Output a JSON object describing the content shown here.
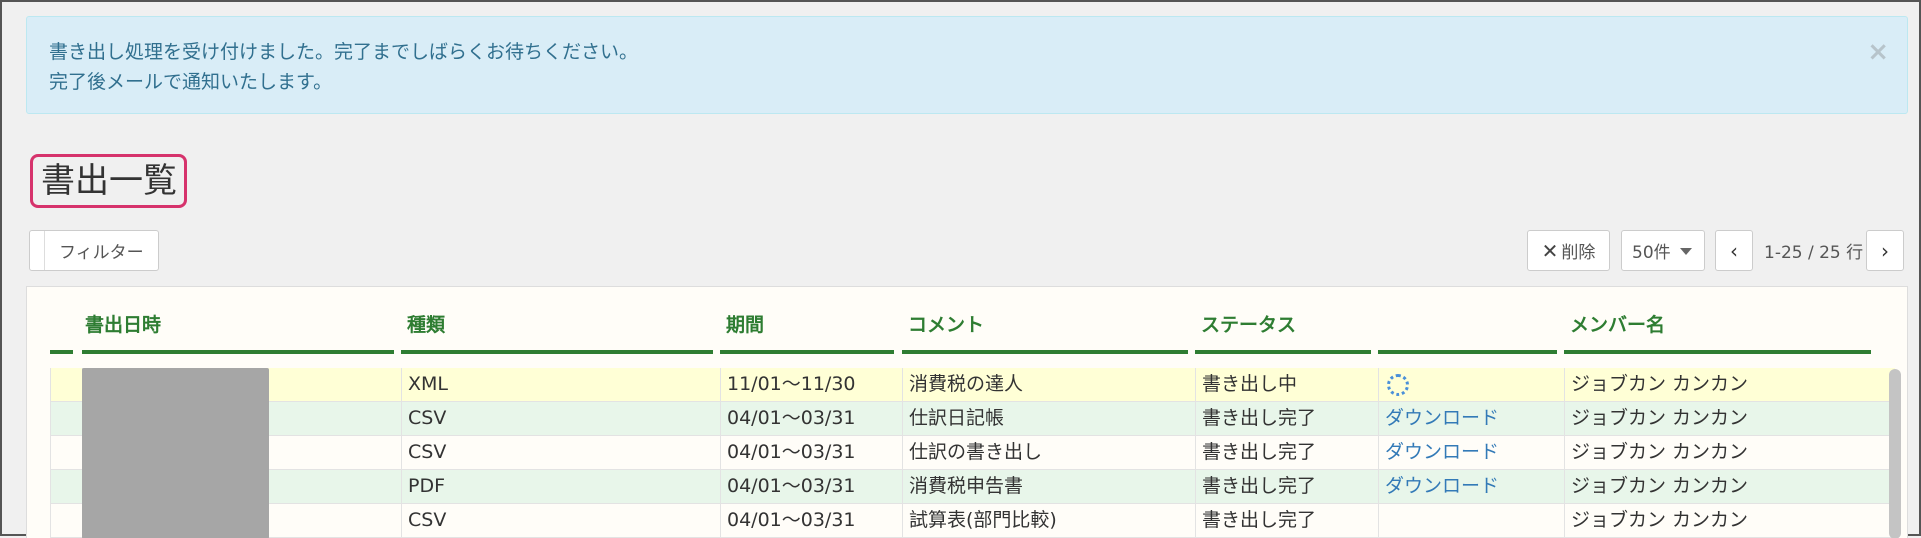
{
  "alert": {
    "line1": "書き出し処理を受け付けました。完了までしばらくお待ちください。",
    "line2": "完了後メールで通知いたします。",
    "close": "×"
  },
  "page_title": "書出一覧",
  "toolbar": {
    "filter_label": "フィルター",
    "delete_label": "削除",
    "per_page": "50件",
    "range": "1-25 / 25 行"
  },
  "table": {
    "headers": [
      "書出日時",
      "種類",
      "期間",
      "コメント",
      "ステータス",
      "",
      "メンバー名"
    ],
    "rows": [
      {
        "type": "XML",
        "period": "11/01～11/30",
        "comment": "消費税の達人",
        "status": "書き出し中",
        "action": "",
        "member": "ジョブカン カンカン",
        "bg": "#ffffd6"
      },
      {
        "type": "CSV",
        "period": "04/01～03/31",
        "comment": "仕訳日記帳",
        "status": "書き出し完了",
        "action": "ダウンロード",
        "member": "ジョブカン カンカン",
        "bg": "#e8f6ea"
      },
      {
        "type": "CSV",
        "period": "04/01～03/31",
        "comment": "仕訳の書き出し",
        "status": "書き出し完了",
        "action": "ダウンロード",
        "member": "ジョブカン カンカン",
        "bg": "#fffdf8"
      },
      {
        "type": "PDF",
        "period": "04/01～03/31",
        "comment": "消費税申告書",
        "status": "書き出し完了",
        "action": "ダウンロード",
        "member": "ジョブカン カンカン",
        "bg": "#e8f6ea"
      },
      {
        "type": "CSV",
        "period": "04/01～03/31",
        "comment": "試算表(部門比較)",
        "status": "書き出し完了",
        "action": "",
        "member": "ジョブカン カンカン",
        "bg": "#fffdf8"
      }
    ]
  }
}
